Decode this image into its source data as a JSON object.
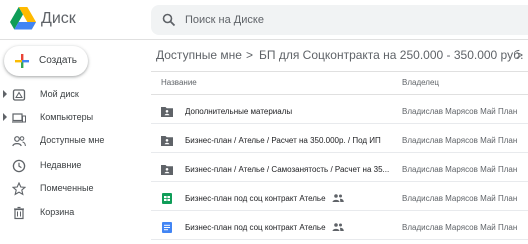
{
  "header": {
    "app_title": "Диск",
    "search_placeholder": "Поиск на Диске"
  },
  "sidebar": {
    "create_label": "Создать",
    "items": [
      {
        "label": "Мой диск",
        "icon": "drive-icon",
        "has_arrow": true
      },
      {
        "label": "Компьютеры",
        "icon": "computer-icon",
        "has_arrow": true
      },
      {
        "label": "Доступные мне",
        "icon": "shared-people-icon",
        "has_arrow": false
      },
      {
        "label": "Недавние",
        "icon": "clock-icon",
        "has_arrow": false
      },
      {
        "label": "Помеченные",
        "icon": "star-icon",
        "has_arrow": false
      },
      {
        "label": "Корзина",
        "icon": "trash-icon",
        "has_arrow": false
      }
    ]
  },
  "breadcrumb": {
    "items": [
      "Доступные мне",
      "БП для Соцконтракта на 250.000 - 350.000 руб."
    ],
    "separator": ">"
  },
  "table": {
    "columns": {
      "name": "Название",
      "owner": "Владелец"
    },
    "rows": [
      {
        "name": "Дополнительные материалы",
        "owner": "Владислав Марясов Май План",
        "type": "shared-folder",
        "shared": false
      },
      {
        "name": "Бизнес-план / Ателье / Расчет на 350.000р. / Под ИП",
        "owner": "Владислав Марясов Май План",
        "type": "shared-folder",
        "shared": false
      },
      {
        "name": "Бизнес-план / Ателье / Самозанятость / Расчет на 35...",
        "owner": "Владислав Марясов Май План",
        "type": "shared-folder",
        "shared": false
      },
      {
        "name": "Бизнес-план под соц контракт Ателье",
        "owner": "Владислав Марясов Май План",
        "type": "spreadsheet",
        "shared": true
      },
      {
        "name": "Бизнес-план под соц контракт Ателье",
        "owner": "Владислав Марясов Май План",
        "type": "document",
        "shared": true
      }
    ]
  },
  "colors": {
    "folder": "#5f6368",
    "sheets": "#0f9d58",
    "docs": "#4285f4",
    "text": "#202124",
    "muted": "#5f6368"
  }
}
